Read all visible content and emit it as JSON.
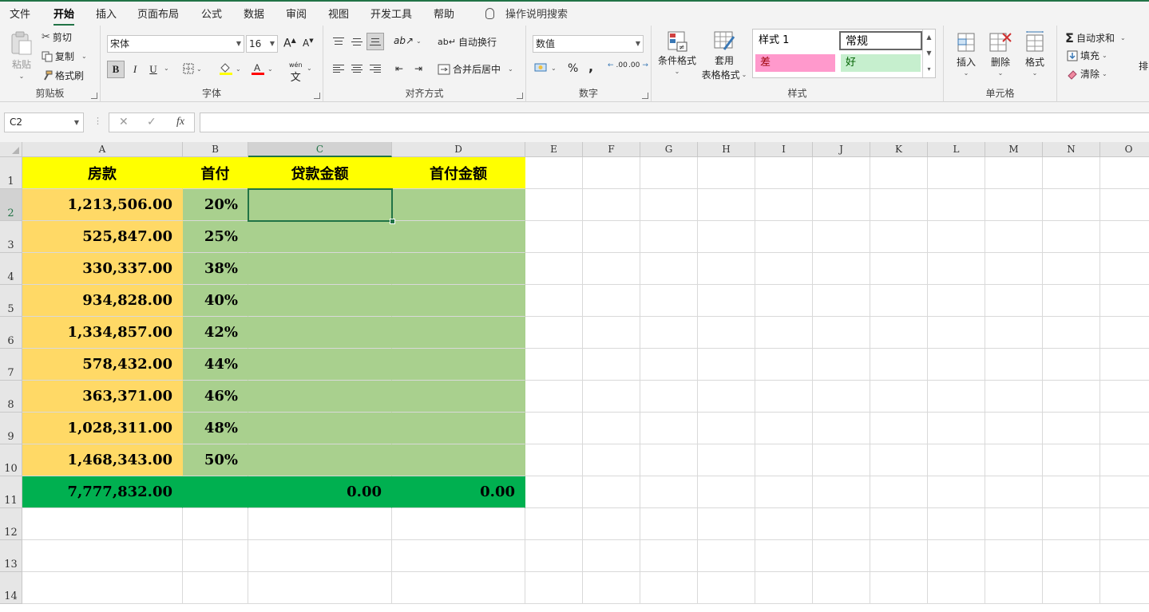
{
  "menu": {
    "tabs": [
      "文件",
      "开始",
      "插入",
      "页面布局",
      "公式",
      "数据",
      "审阅",
      "视图",
      "开发工具",
      "帮助"
    ],
    "active_tab": "开始",
    "tell_me": "操作说明搜索"
  },
  "ribbon": {
    "clipboard": {
      "label": "剪贴板",
      "paste": "粘贴",
      "cut": "剪切",
      "copy": "复制",
      "format_painter": "格式刷"
    },
    "font": {
      "label": "字体",
      "font_name": "宋体",
      "font_size": "16",
      "bold": "B",
      "italic": "I",
      "underline": "U",
      "phonetic": "wén"
    },
    "alignment": {
      "label": "对齐方式",
      "wrap_text": "自动换行",
      "merge_center": "合并后居中"
    },
    "number": {
      "label": "数字",
      "format": "数值",
      "percent": "%",
      "comma": ",",
      "inc_decimal": ".00",
      "dec_decimal": ".00"
    },
    "styles": {
      "label": "样式",
      "conditional": [
        "条件格式"
      ],
      "table": [
        "套用",
        "表格格式"
      ],
      "gallery": {
        "style1": "样式 1",
        "normal": "常规",
        "bad": "差",
        "good": "好"
      }
    },
    "cells": {
      "label": "单元格",
      "insert": "插入",
      "delete": "删除",
      "format": "格式"
    },
    "editing": {
      "autosum": "自动求和",
      "fill": "填充",
      "clear": "清除",
      "sort_partial": "排"
    }
  },
  "formula_bar": {
    "name_box": "C2",
    "formula": "",
    "fx": "fx"
  },
  "sheet": {
    "columns": [
      "A",
      "B",
      "C",
      "D",
      "E",
      "F",
      "G",
      "H",
      "I",
      "J",
      "K",
      "L",
      "M",
      "N",
      "O"
    ],
    "rows": [
      "1",
      "2",
      "3",
      "4",
      "5",
      "6",
      "7",
      "8",
      "9",
      "10",
      "11",
      "12",
      "13",
      "14"
    ],
    "selected_cell": "C2",
    "headers": [
      "房款",
      "首付",
      "贷款金额",
      "首付金额"
    ],
    "data": [
      [
        "1,213,506.00",
        "20%"
      ],
      [
        "525,847.00",
        "25%"
      ],
      [
        "330,337.00",
        "38%"
      ],
      [
        "934,828.00",
        "40%"
      ],
      [
        "1,334,857.00",
        "42%"
      ],
      [
        "578,432.00",
        "44%"
      ],
      [
        "363,371.00",
        "46%"
      ],
      [
        "1,028,311.00",
        "48%"
      ],
      [
        "1,468,343.00",
        "50%"
      ]
    ],
    "totals": [
      "7,777,832.00",
      "",
      "0.00",
      "0.00"
    ]
  },
  "colors": {
    "accent": "#217346",
    "header_fill": "#FFFF00",
    "col_a_fill": "#FFD966",
    "col_bcd_fill": "#A9D08E",
    "total_fill": "#00B050",
    "style_bad_bg": "#FF99CC",
    "style_bad_fg": "#9C0006",
    "style_good_bg": "#C6EFCE",
    "style_good_fg": "#006100"
  }
}
